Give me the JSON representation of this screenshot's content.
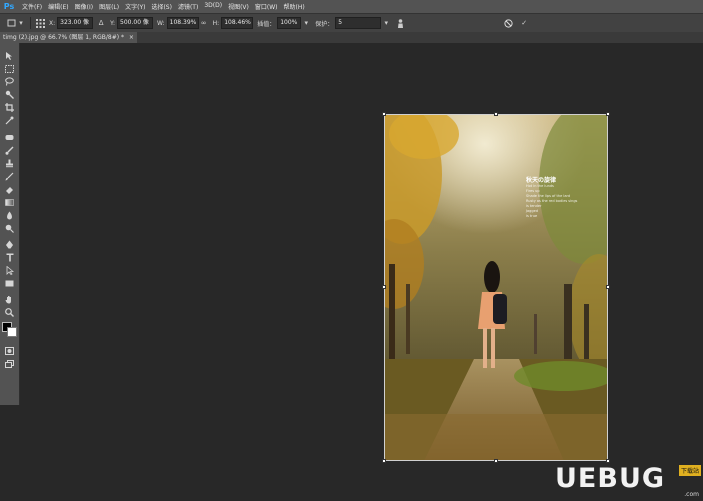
{
  "app": {
    "logo": "Ps"
  },
  "menu": {
    "items": [
      "文件(F)",
      "编辑(E)",
      "图像(I)",
      "图层(L)",
      "文字(Y)",
      "选择(S)",
      "滤镜(T)",
      "3D(D)",
      "视图(V)",
      "窗口(W)",
      "帮助(H)"
    ]
  },
  "options": {
    "x_label": "X:",
    "x_value": "323.00 像",
    "y_label": "Y:",
    "y_value": "500.00 像",
    "w_label": "W:",
    "w_value": "108.39%",
    "h_label": "H:",
    "h_value": "108.46%",
    "interp_label": "插值：",
    "interp_value": "100%",
    "protect_label": "保护：",
    "protect_value": "5"
  },
  "document": {
    "tab_title": "timg (2).jpg @ 66.7% (图层 1, RGB/8#) *",
    "close_glyph": "×"
  },
  "overlay": {
    "title": "秋天の旋律",
    "lines": [
      "Hot in the lunds",
      "Fires up",
      "Shade the lips of the lard",
      "Rusty as the red bodies sings",
      "is tender",
      "Jagged",
      "is true"
    ]
  },
  "watermark": {
    "text": "UEBUG",
    "badge": "下载站",
    "sub": ".com"
  },
  "tools": [
    "move-tool-icon",
    "marquee-tool-icon",
    "lasso-tool-icon",
    "quick-select-icon",
    "crop-tool-icon",
    "eyedropper-icon",
    "healing-brush-icon",
    "brush-tool-icon",
    "clone-stamp-icon",
    "history-brush-icon",
    "eraser-icon",
    "gradient-icon",
    "blur-icon",
    "dodge-icon",
    "pen-tool-icon",
    "type-tool-icon",
    "path-select-icon",
    "rectangle-tool-icon",
    "hand-tool-icon",
    "zoom-tool-icon"
  ]
}
